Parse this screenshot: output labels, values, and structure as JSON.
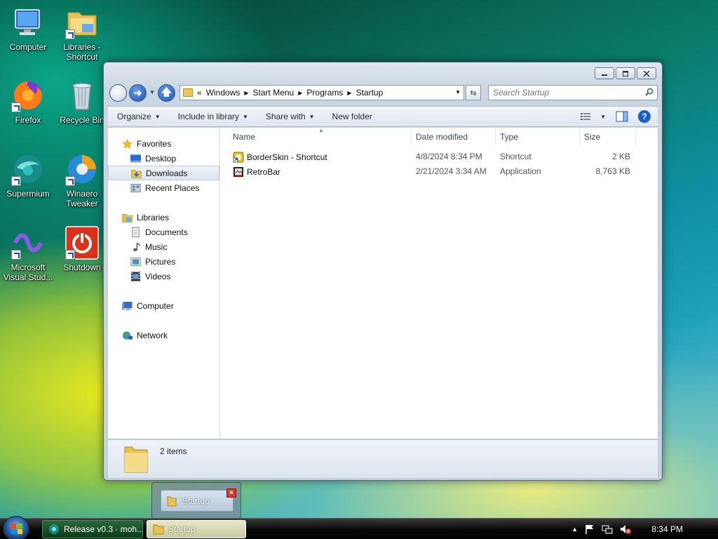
{
  "desktop": {
    "icons": [
      {
        "label": "Computer"
      },
      {
        "label": "Libraries - Shortcut"
      },
      {
        "label": "Firefox"
      },
      {
        "label": "Recycle Bin"
      },
      {
        "label": "Supermium"
      },
      {
        "label": "Winaero Tweaker"
      },
      {
        "label": "Microsoft Visual Stud..."
      },
      {
        "label": "Shutdown"
      }
    ]
  },
  "window": {
    "address": {
      "overflow": "«",
      "crumbs": [
        "Windows",
        "Start Menu",
        "Programs",
        "Startup"
      ]
    },
    "search": {
      "placeholder": "Search Startup"
    },
    "toolbar": {
      "organize": "Organize",
      "include": "Include in library",
      "share": "Share with",
      "new_folder": "New folder"
    },
    "nav": {
      "favorites": "Favorites",
      "desktop": "Desktop",
      "downloads": "Downloads",
      "recent": "Recent Places",
      "libraries": "Libraries",
      "documents": "Documents",
      "music": "Music",
      "pictures": "Pictures",
      "videos": "Videos",
      "computer": "Computer",
      "network": "Network"
    },
    "columns": {
      "name": "Name",
      "date": "Date modified",
      "type": "Type",
      "size": "Size"
    },
    "files": [
      {
        "name": "BorderSkin - Shortcut",
        "date": "4/8/2024 8:34 PM",
        "type": "Shortcut",
        "size": "2 KB"
      },
      {
        "name": "RetroBar",
        "date": "2/21/2024 3:34 AM",
        "type": "Application",
        "size": "8,763 KB"
      }
    ],
    "details": {
      "count": "2 items"
    }
  },
  "thumbnail": {
    "label": "Startup",
    "close": "×"
  },
  "taskbar": {
    "buttons": [
      {
        "label": "Release v0.3 · moh..."
      },
      {
        "label": "Startup"
      }
    ],
    "clock": "8:34 PM"
  },
  "colors": {
    "accent": "#1a4fb0",
    "selection": "#dde6ee",
    "close_red": "#d23a2a"
  }
}
